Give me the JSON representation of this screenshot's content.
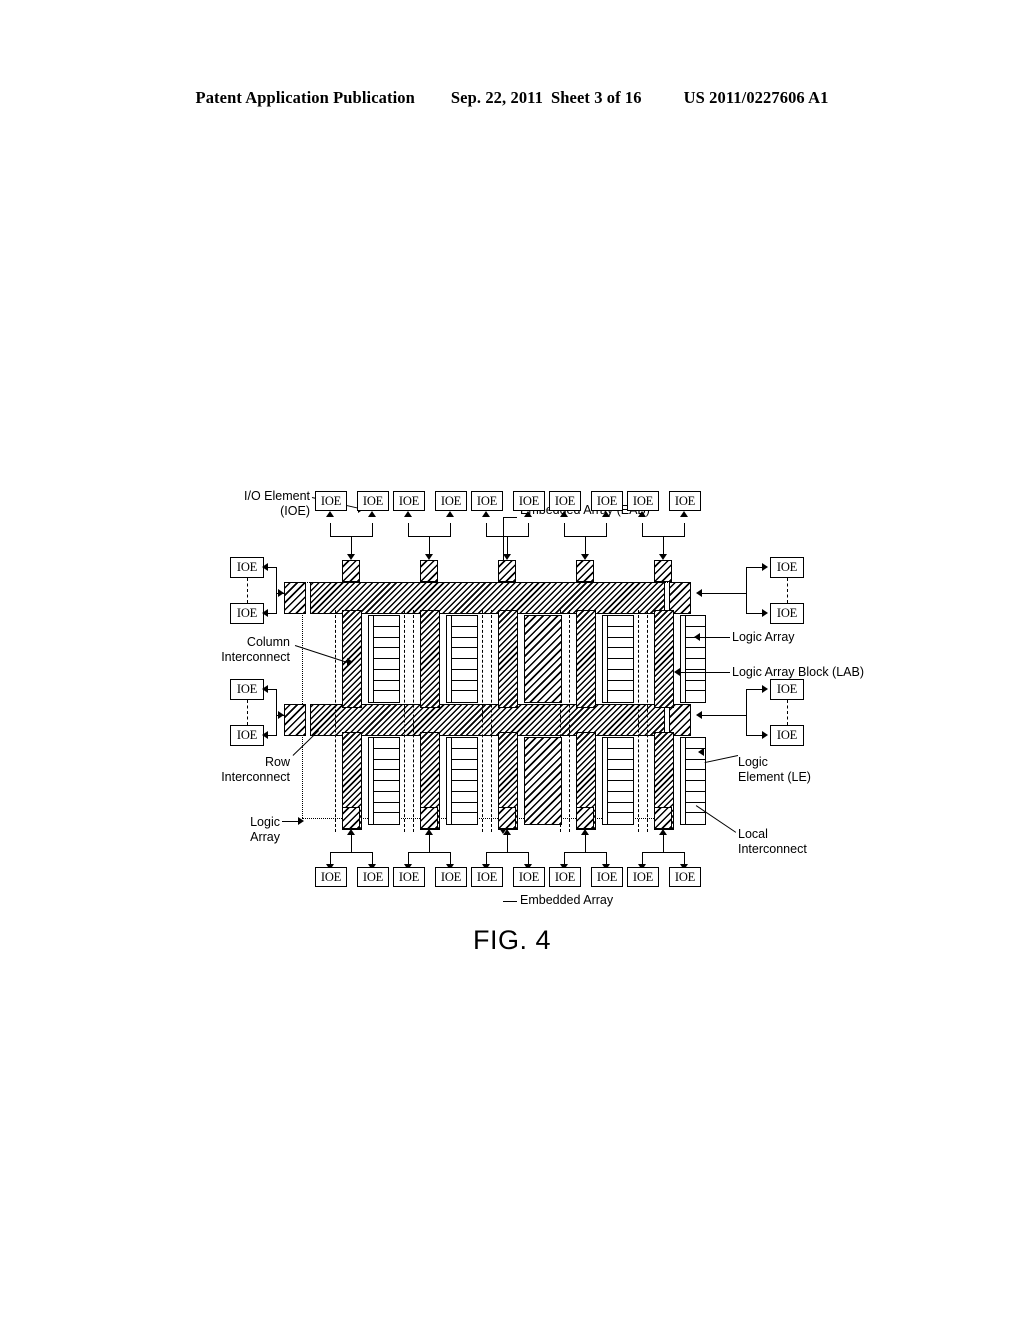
{
  "header": {
    "publication": "Patent Application Publication",
    "date": "Sep. 22, 2011",
    "sheet": "Sheet 3 of 16",
    "number": "US 2011/0227606 A1"
  },
  "figure": {
    "caption": "FIG. 4",
    "ioe_label": "IOE",
    "labels": {
      "io_element": "I/O Element\n(IOE)",
      "embedded_array_eab": "Embedded Array (EAB)",
      "column_interconnect": "Column\nInterconnect",
      "row_interconnect": "Row\nInterconnect",
      "logic_array_left": "Logic\nArray",
      "logic_array_right": "Logic Array",
      "logic_array_block": "Logic Array Block (LAB)",
      "logic_element": "Logic\nElement (LE)",
      "local_interconnect": "Local\nInterconnect",
      "embedded_array_bottom": "Embedded Array"
    },
    "top_ioe_row": [
      "IOE",
      "IOE",
      "IOE",
      "IOE",
      "IOE",
      "IOE",
      "IOE",
      "IOE",
      "IOE",
      "IOE"
    ],
    "bottom_ioe_row": [
      "IOE",
      "IOE",
      "IOE",
      "IOE",
      "IOE",
      "IOE",
      "IOE",
      "IOE",
      "IOE",
      "IOE"
    ],
    "left_ioe_pairs": [
      [
        "IOE",
        "IOE"
      ],
      [
        "IOE",
        "IOE"
      ]
    ],
    "right_ioe_pairs": [
      [
        "IOE",
        "IOE"
      ],
      [
        "IOE",
        "IOE"
      ]
    ],
    "columns": [
      {
        "kind": "lab",
        "le_count": 8
      },
      {
        "kind": "lab",
        "le_count": 8
      },
      {
        "kind": "eab",
        "le_count": 0
      },
      {
        "kind": "lab",
        "le_count": 8
      },
      {
        "kind": "lab-partial",
        "le_count": 8
      }
    ],
    "rows": 2,
    "colors": {
      "ink": "#000000",
      "paper": "#ffffff"
    }
  }
}
